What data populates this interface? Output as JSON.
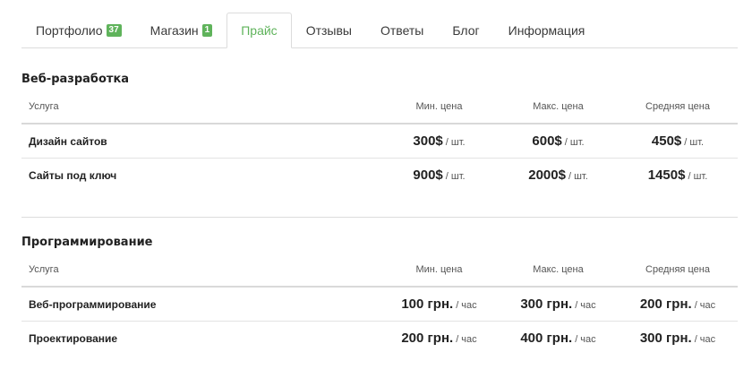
{
  "tabs": [
    {
      "label": "Портфолио",
      "badge": "37"
    },
    {
      "label": "Магазин",
      "badge": "1"
    },
    {
      "label": "Прайс"
    },
    {
      "label": "Отзывы"
    },
    {
      "label": "Ответы"
    },
    {
      "label": "Блог"
    },
    {
      "label": "Информация"
    }
  ],
  "accent_color": "#5fb35b",
  "sections": [
    {
      "title": "Веб-разработка",
      "headers": {
        "service": "Услуга",
        "min": "Мин. цена",
        "max": "Макс. цена",
        "avg": "Средняя цена"
      },
      "rows": [
        {
          "service": "Дизайн сайтов",
          "min": "300$",
          "max": "600$",
          "avg": "450$",
          "unit": "/ шт."
        },
        {
          "service": "Сайты под ключ",
          "min": "900$",
          "max": "2000$",
          "avg": "1450$",
          "unit": "/ шт."
        }
      ]
    },
    {
      "title": "Программирование",
      "headers": {
        "service": "Услуга",
        "min": "Мин. цена",
        "max": "Макс. цена",
        "avg": "Средняя цена"
      },
      "rows": [
        {
          "service": "Веб-программирование",
          "min": "100 грн.",
          "max": "300 грн.",
          "avg": "200 грн.",
          "unit": "/ час"
        },
        {
          "service": "Проектирование",
          "min": "200 грн.",
          "max": "400 грн.",
          "avg": "300 грн.",
          "unit": "/ час"
        }
      ]
    }
  ]
}
